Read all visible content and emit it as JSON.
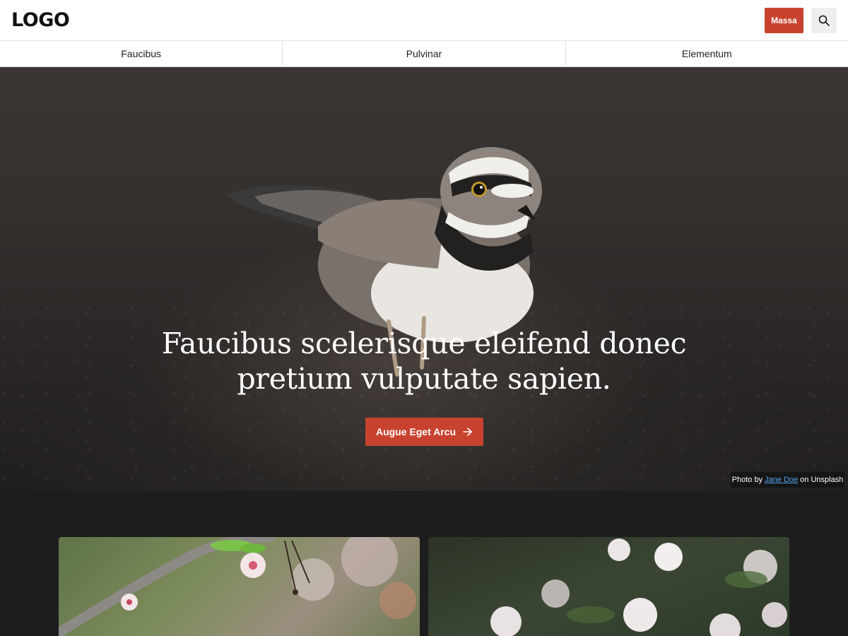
{
  "header": {
    "logo_text": "LOGO",
    "cta_label": "Massa",
    "search_icon": "search-icon"
  },
  "nav": {
    "items": [
      {
        "label": "Faucibus"
      },
      {
        "label": "Pulvinar"
      },
      {
        "label": "Elementum"
      }
    ]
  },
  "hero": {
    "title": "Faucibus scelerisque eleifend donec pretium vulputate sapien.",
    "button_label": "Augue Eget Arcu",
    "button_icon": "arrow-right-icon",
    "credit": {
      "prefix": "Photo by",
      "author": "Jane Doe",
      "suffix": "on Unsplash"
    }
  },
  "cards": [
    {
      "image": "cherry-blossom-branch"
    },
    {
      "image": "cherry-blossom-cluster"
    }
  ],
  "colors": {
    "accent": "#c8432f",
    "header_bg": "#ffffff",
    "page_bg": "#1d1d1d",
    "link": "#4ea3f0"
  }
}
